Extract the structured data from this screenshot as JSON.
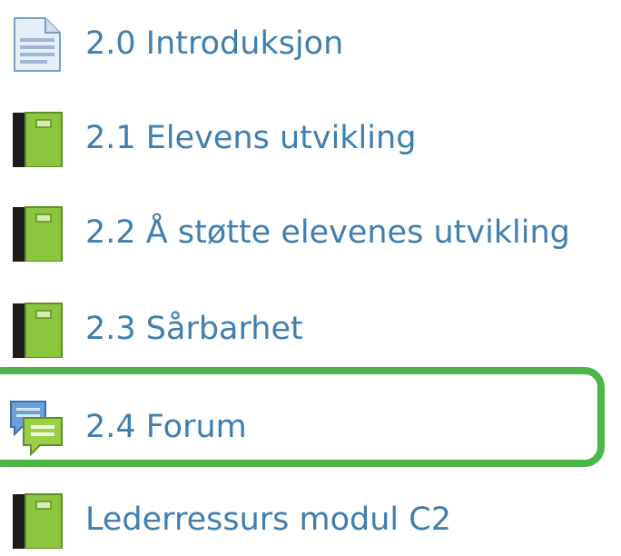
{
  "activity_list": {
    "items": [
      {
        "label": "2.0 Introduksjon",
        "icon": "page-icon"
      },
      {
        "label": "2.1 Elevens utvikling",
        "icon": "book-icon"
      },
      {
        "label": "2.2 Å støtte elevenes utvikling",
        "icon": "book-icon"
      },
      {
        "label": "2.3 Sårbarhet",
        "icon": "book-icon"
      },
      {
        "label": "2.4 Forum",
        "icon": "forum-icon"
      },
      {
        "label": "Lederressurs modul C2",
        "icon": "book-icon"
      }
    ],
    "highlighted_item": "2.4 Forum"
  },
  "colors": {
    "link": "#3e7fb0",
    "highlight_border": "#4cb648",
    "book_green": "#8cc63f",
    "book_spine": "#1c1c1c"
  }
}
